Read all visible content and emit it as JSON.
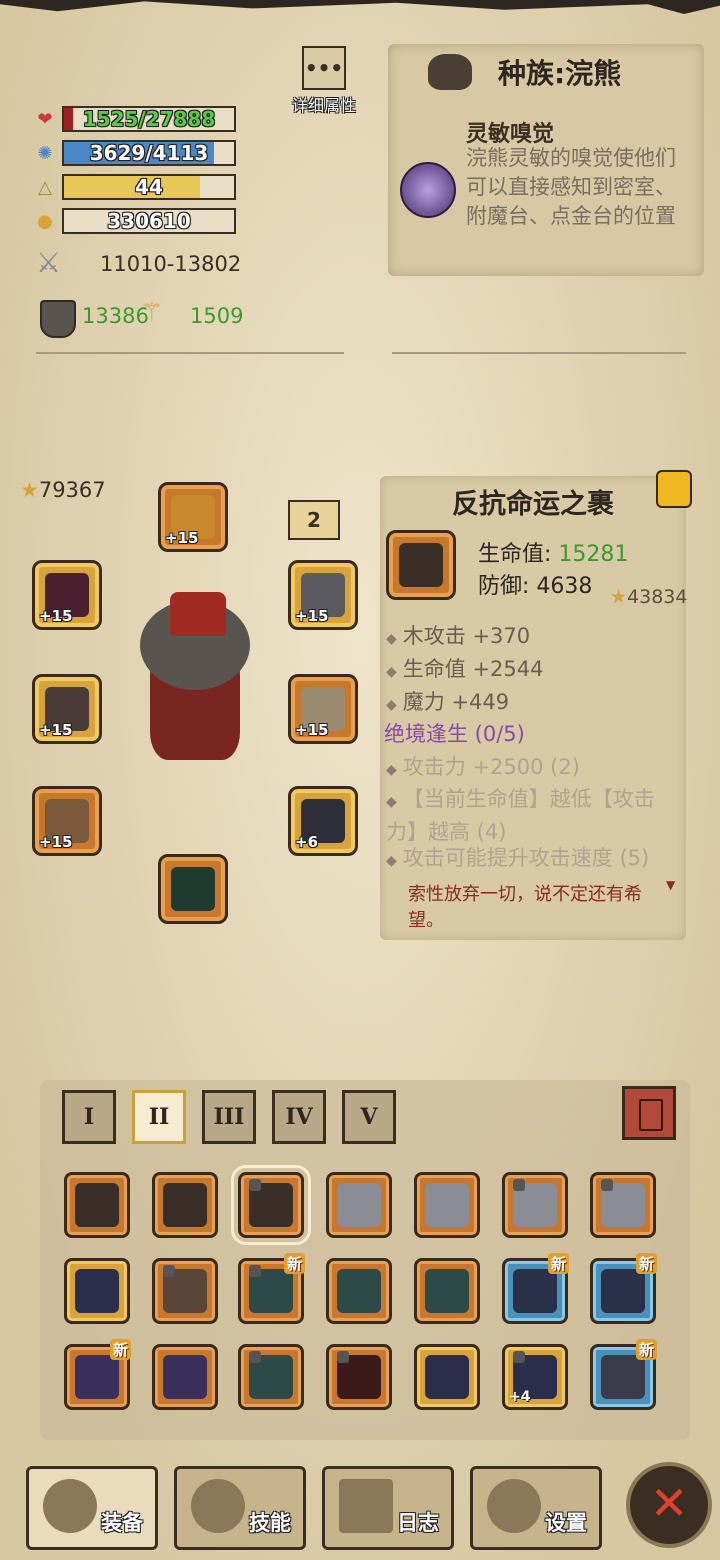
{
  "stats": {
    "hp": "1525/27888",
    "hp_fill": 0.055,
    "mana": "3629/4113",
    "mana_fill": 0.88,
    "level": "44",
    "level_fill": 0.8,
    "gold": "330610",
    "attack": "11010-13802",
    "defense": "13386",
    "magic": "1509"
  },
  "detail_button": {
    "glyph": "•••",
    "label": "详细属性"
  },
  "race": {
    "title": "种族:浣熊",
    "skill_name": "灵敏嗅觉",
    "skill_desc": "浣熊灵敏的嗅觉使他们可以直接感知到密室、附魔台、点金台的位置"
  },
  "equipment": {
    "score": "79367",
    "bag_count": "2",
    "slots": [
      {
        "name": "helmet",
        "level": "+15"
      },
      {
        "name": "left-1",
        "level": "+15"
      },
      {
        "name": "right-1",
        "level": "+15"
      },
      {
        "name": "left-2",
        "level": "+15"
      },
      {
        "name": "right-2",
        "level": "+15"
      },
      {
        "name": "left-3",
        "level": "+15"
      },
      {
        "name": "right-3",
        "level": "+6"
      },
      {
        "name": "bottom",
        "level": ""
      }
    ]
  },
  "item": {
    "title": "反抗命运之裹",
    "hp_label": "生命值:",
    "hp_value": "15281",
    "def_label": "防御:",
    "def_value": "4638",
    "score": "43834",
    "bonuses": [
      "木攻击 +370",
      "生命值 +2544",
      "魔力 +449"
    ],
    "set_name": "绝境逢生 (0/5)",
    "set_effects": [
      "攻击力 +2500 (2)",
      "【当前生命值】越低【攻击力】越高 (4)",
      "攻击可能提升攻击速度 (5)"
    ],
    "flavor": "索性放弃一切，说不定还有希望。"
  },
  "inventory": {
    "tabs": [
      "I",
      "II",
      "III",
      "IV",
      "V"
    ],
    "active_tab": 1,
    "new_badge": "新",
    "plus4": "+4"
  },
  "nav": {
    "equip": "装备",
    "skills": "技能",
    "log": "日志",
    "settings": "设置",
    "close": "✕"
  },
  "colors": {
    "hp_bar": "#4aa83a",
    "mana_bar": "#4a88c8",
    "level_bar": "#e8c858",
    "green_text": "#3a9a2a",
    "set_purple": "#8a4aa8",
    "flavor_red": "#8a2a1e"
  }
}
